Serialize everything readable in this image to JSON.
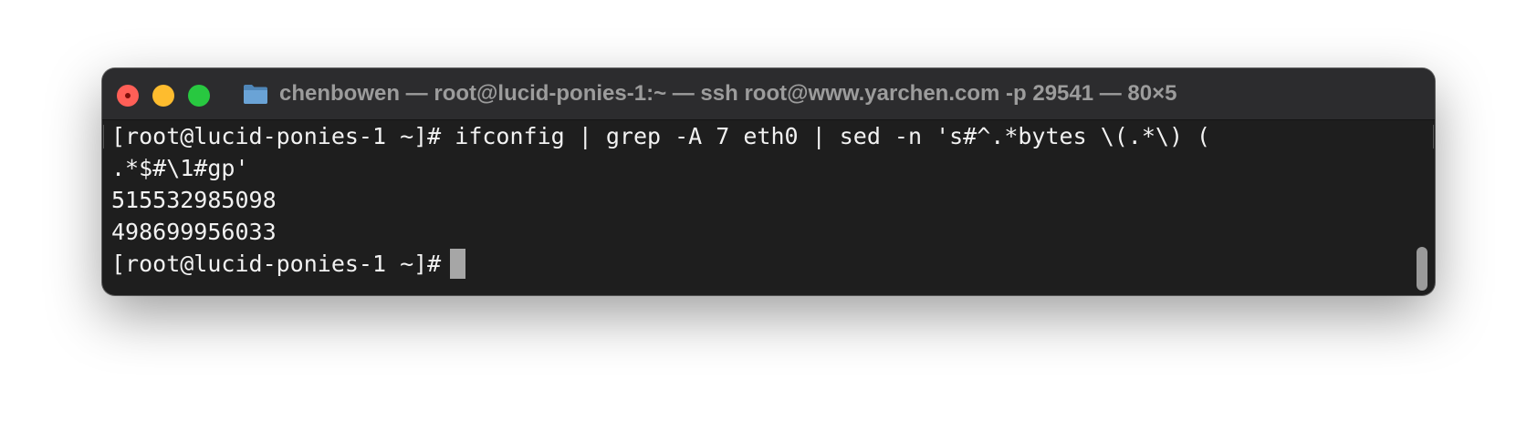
{
  "window": {
    "title": "chenbowen — root@lucid-ponies-1:~ — ssh root@www.yarchen.com -p 29541 — 80×5"
  },
  "terminal": {
    "lines": [
      "[root@lucid-ponies-1 ~]# ifconfig | grep -A 7 eth0 | sed -n 's#^.*bytes \\(.*\\) (",
      ".*$#\\1#gp'",
      "515532985098",
      "498699956033"
    ],
    "prompt": "[root@lucid-ponies-1 ~]#"
  },
  "icons": {
    "close": "close-button",
    "minimize": "minimize-button",
    "zoom": "zoom-button",
    "folder": "folder-icon"
  },
  "colors": {
    "close": "#ff5f57",
    "minimize": "#febc2e",
    "zoom": "#28c840",
    "terminal_bg": "#1e1e1e",
    "titlebar_bg": "#2c2c2e"
  }
}
